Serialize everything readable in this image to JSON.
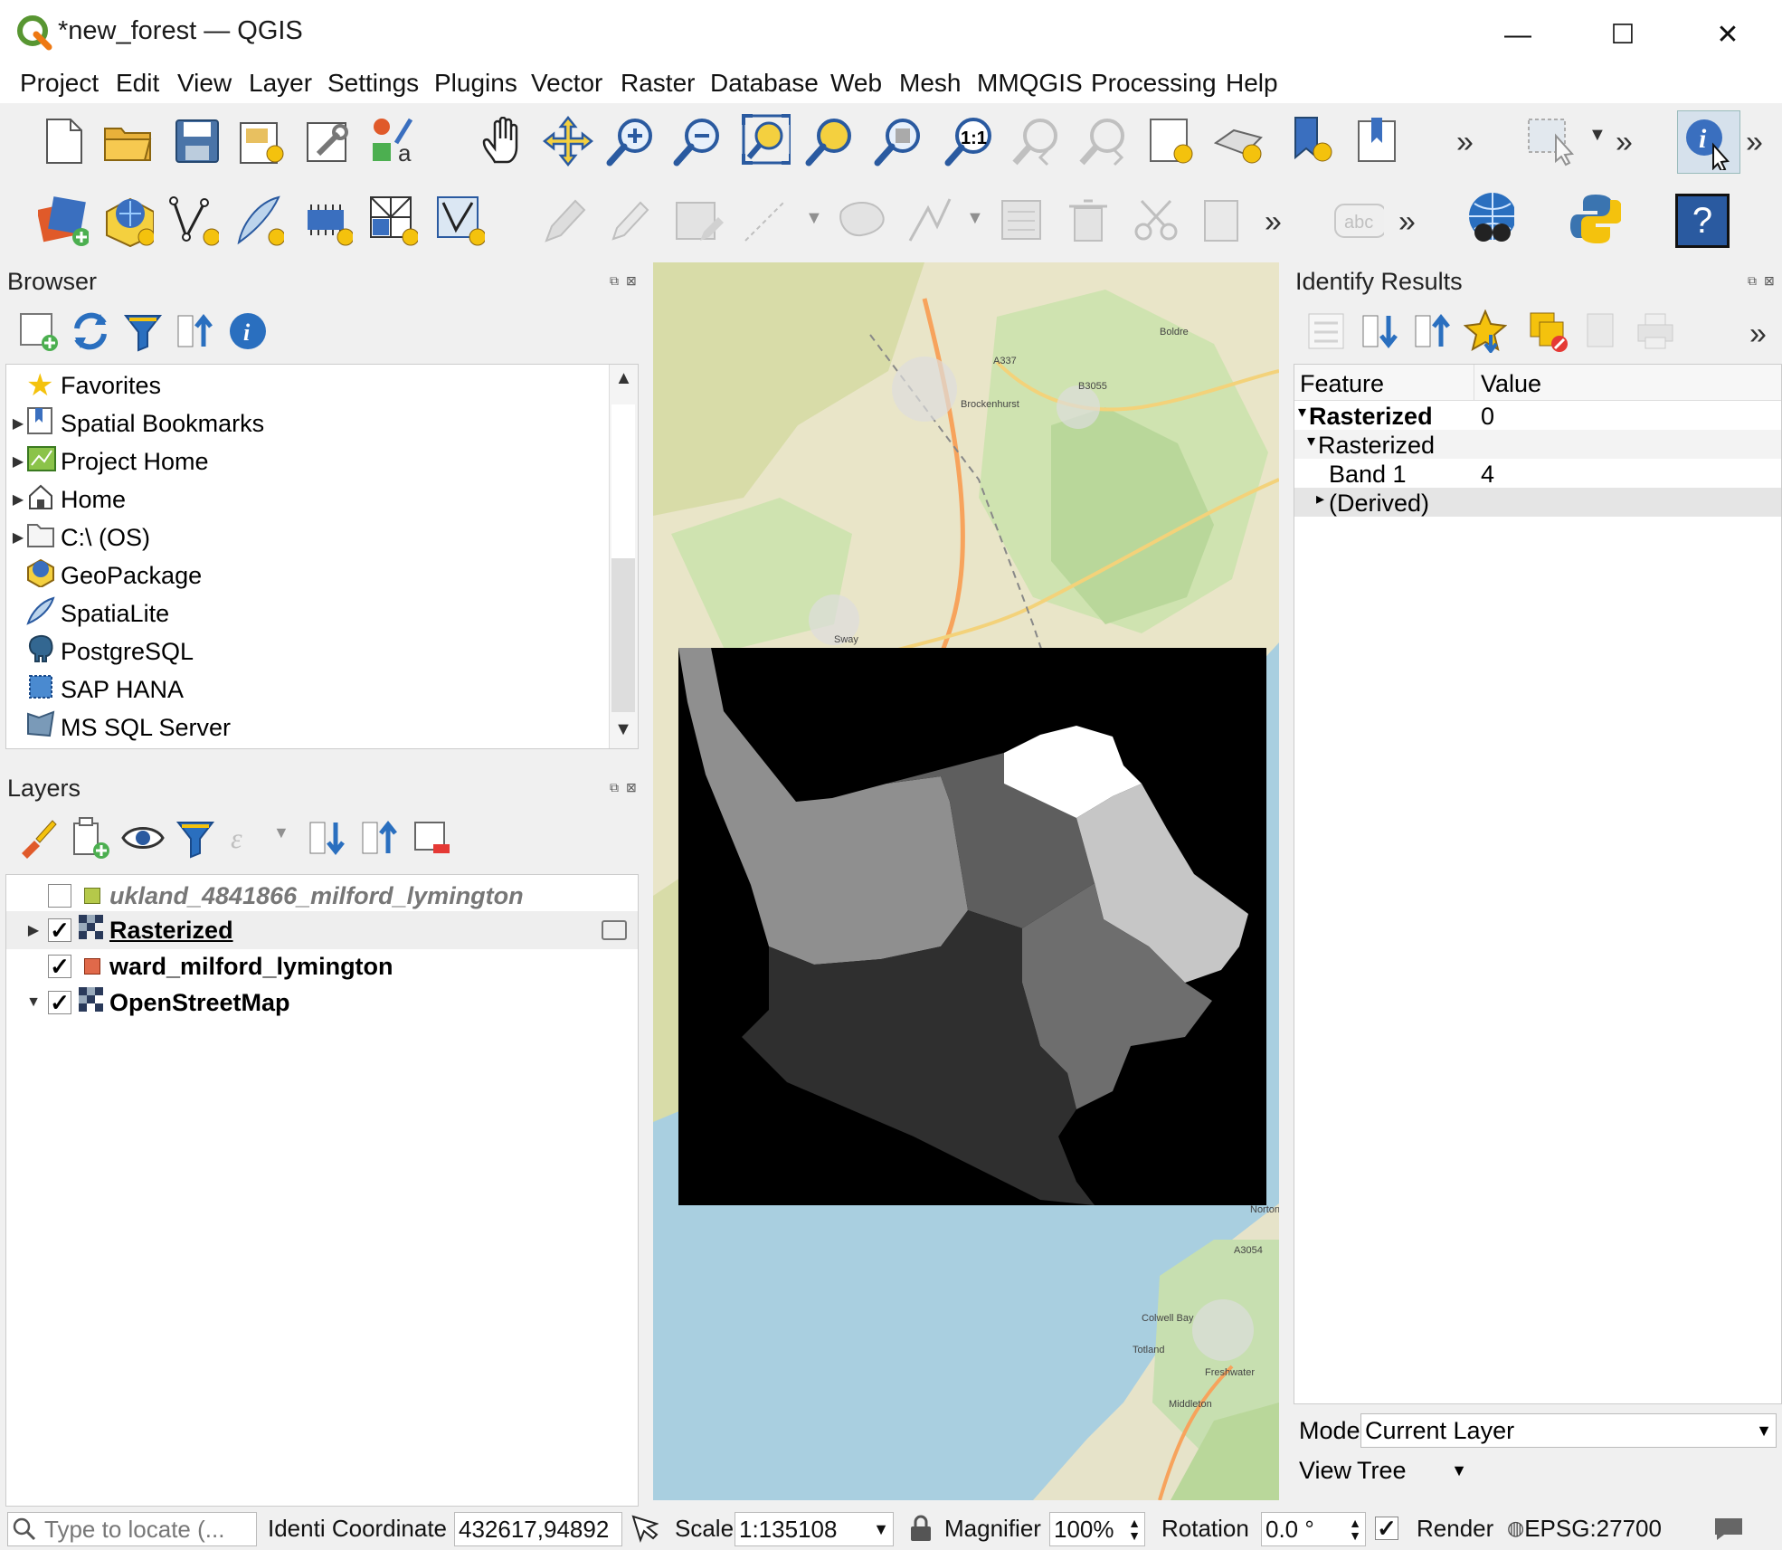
{
  "window": {
    "title": "*new_forest — QGIS",
    "minimize": "—",
    "maximize": "☐",
    "close": "✕"
  },
  "menu": [
    "Project",
    "Edit",
    "View",
    "Layer",
    "Settings",
    "Plugins",
    "Vector",
    "Raster",
    "Database",
    "Web",
    "Mesh",
    "MMQGIS",
    "Processing",
    "Help"
  ],
  "toolbar": {
    "overflow": "»",
    "labeling_text": "abc",
    "help_glyph": "?",
    "scale_1_1": "1:1"
  },
  "browser": {
    "title": "Browser",
    "items": [
      {
        "label": "Favorites",
        "expandable": false,
        "icon": "star-icon"
      },
      {
        "label": "Spatial Bookmarks",
        "expandable": true,
        "icon": "bookmark-icon"
      },
      {
        "label": "Project Home",
        "expandable": true,
        "icon": "project-home-icon"
      },
      {
        "label": "Home",
        "expandable": true,
        "icon": "home-icon"
      },
      {
        "label": "C:\\ (OS)",
        "expandable": true,
        "icon": "folder-icon"
      },
      {
        "label": "GeoPackage",
        "expandable": false,
        "icon": "geopackage-icon"
      },
      {
        "label": "SpatiaLite",
        "expandable": false,
        "icon": "spatialite-icon"
      },
      {
        "label": "PostgreSQL",
        "expandable": false,
        "icon": "postgresql-icon"
      },
      {
        "label": "SAP HANA",
        "expandable": false,
        "icon": "sap-hana-icon"
      },
      {
        "label": "MS SQL Server",
        "expandable": false,
        "icon": "mssql-icon"
      }
    ]
  },
  "layers": {
    "title": "Layers",
    "items": [
      {
        "name": "ukland_4841866_milford_lymington",
        "checked": false,
        "color": "#b5c94a",
        "italic": true
      },
      {
        "name": "Rasterized",
        "checked": true,
        "raster": true,
        "underline": true,
        "expander": "▶"
      },
      {
        "name": "ward_milford_lymington",
        "checked": true,
        "color": "#e0694a"
      },
      {
        "name": "OpenStreetMap",
        "checked": true,
        "raster": true,
        "expander": "▼"
      }
    ]
  },
  "identify": {
    "title": "Identify Results",
    "col_feature": "Feature",
    "col_value": "Value",
    "rows": [
      {
        "feature": "Rasterized",
        "value": "0",
        "bold": true,
        "indent": 0,
        "arrow": "▾"
      },
      {
        "feature": "Rasterized",
        "value": "",
        "indent": 1,
        "arrow": "▾"
      },
      {
        "feature": "Band 1",
        "value": "4",
        "indent": 2,
        "arrow": ""
      },
      {
        "feature": "(Derived)",
        "value": "",
        "indent": 2,
        "arrow": "▸"
      }
    ],
    "mode_label": "Mode",
    "mode_value": "Current Layer",
    "view_label": "View",
    "view_value": "Tree"
  },
  "map": {
    "labels": [
      "Brockenhurst",
      "Boldre",
      "Sway",
      "Norton",
      "Colwell Bay",
      "Totland",
      "Freshwater",
      "Middleton",
      "A337",
      "B3055",
      "A3054"
    ]
  },
  "status": {
    "locate_placeholder": "Type to locate (...",
    "coord_label": "Identi Coordinate",
    "coordinate": "432617,94892",
    "scale_label": "Scale",
    "scale": "1:135108",
    "magnifier_label": "Magnifier",
    "magnifier": "100%",
    "rotation_label": "Rotation",
    "rotation": "0.0 °",
    "render_label": "Render",
    "crs": "EPSG:27700"
  }
}
